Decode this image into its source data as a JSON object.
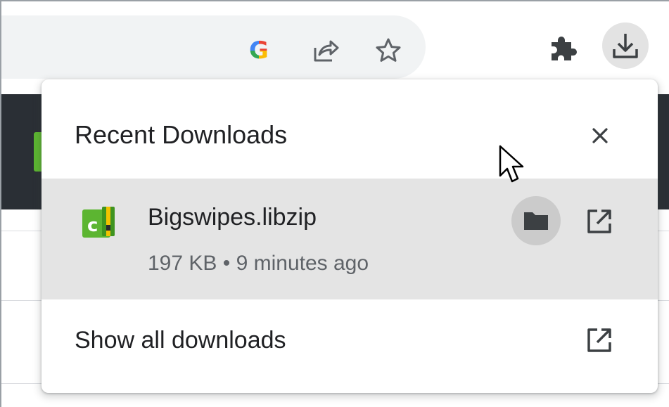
{
  "toolbar": {
    "icons": {
      "google": "google-g-icon",
      "share": "share-icon",
      "bookmark": "star-icon",
      "extensions": "puzzle-icon",
      "downloads": "download-icon"
    },
    "google_glyph": "G"
  },
  "popup": {
    "title": "Recent Downloads",
    "close_icon": "close-icon",
    "item": {
      "file_name": "Bigswipes.libzip",
      "meta": "197 KB • 9 minutes ago",
      "file_icon": "libzip-file-icon",
      "file_icon_glyph": "c",
      "folder_icon": "folder-icon",
      "open_icon": "open-external-icon"
    },
    "show_all_label": "Show all downloads",
    "show_all_icon": "open-external-icon"
  },
  "colors": {
    "popup_bg": "#ffffff",
    "item_hover_bg": "#e4e4e4",
    "folder_btn_hover": "#cbcbcb",
    "title_text": "#202124",
    "meta_text": "#5f6368",
    "file_icon_green": "#5cb531"
  }
}
